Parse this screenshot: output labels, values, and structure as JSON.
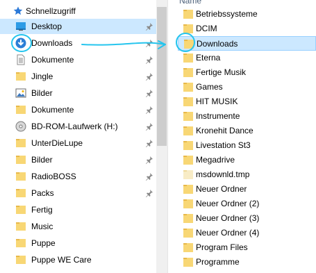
{
  "nav": {
    "quick_access_label": "Schnellzugriff",
    "items": [
      {
        "label": "Desktop",
        "icon": "desktop-icon",
        "pinned": true
      },
      {
        "label": "Downloads",
        "icon": "download-arrow-icon",
        "pinned": true
      },
      {
        "label": "Dokumente",
        "icon": "document-icon",
        "pinned": true
      },
      {
        "label": "Jingle",
        "icon": "folder-icon",
        "pinned": true
      },
      {
        "label": "Bilder",
        "icon": "pictures-icon",
        "pinned": true
      },
      {
        "label": "Dokumente",
        "icon": "folder-icon",
        "pinned": true
      },
      {
        "label": "BD-ROM-Laufwerk (H:)",
        "icon": "disc-drive-icon",
        "pinned": true
      },
      {
        "label": "UnterDieLupe",
        "icon": "folder-icon",
        "pinned": true
      },
      {
        "label": "Bilder",
        "icon": "folder-icon",
        "pinned": true
      },
      {
        "label": "RadioBOSS",
        "icon": "folder-icon",
        "pinned": true
      },
      {
        "label": "Packs",
        "icon": "folder-icon",
        "pinned": true
      },
      {
        "label": "Fertig",
        "icon": "folder-icon",
        "pinned": false
      },
      {
        "label": "Music",
        "icon": "folder-icon",
        "pinned": false
      },
      {
        "label": "Puppe",
        "icon": "folder-icon",
        "pinned": false
      },
      {
        "label": "Puppe WE Care",
        "icon": "folder-icon",
        "pinned": false
      }
    ]
  },
  "list": {
    "header": "Name",
    "items": [
      {
        "label": "Betriebssysteme",
        "icon": "folder-icon"
      },
      {
        "label": "DCIM",
        "icon": "folder-icon"
      },
      {
        "label": "Downloads",
        "icon": "folder-icon"
      },
      {
        "label": "Eterna",
        "icon": "folder-icon"
      },
      {
        "label": "Fertige Musik",
        "icon": "folder-icon"
      },
      {
        "label": "Games",
        "icon": "folder-icon"
      },
      {
        "label": "HIT MUSIK",
        "icon": "folder-icon"
      },
      {
        "label": "Instrumente",
        "icon": "folder-icon"
      },
      {
        "label": "Kronehit Dance",
        "icon": "folder-icon"
      },
      {
        "label": "Livestation St3",
        "icon": "folder-icon"
      },
      {
        "label": "Megadrive",
        "icon": "folder-icon"
      },
      {
        "label": "msdownld.tmp",
        "icon": "hidden-folder-icon"
      },
      {
        "label": "Neuer Ordner",
        "icon": "folder-icon"
      },
      {
        "label": "Neuer Ordner (2)",
        "icon": "folder-icon"
      },
      {
        "label": "Neuer Ordner (3)",
        "icon": "folder-icon"
      },
      {
        "label": "Neuer Ordner (4)",
        "icon": "folder-icon"
      },
      {
        "label": "Program Files",
        "icon": "folder-icon"
      },
      {
        "label": "Programme",
        "icon": "folder-icon"
      }
    ]
  },
  "colors": {
    "selection": "#cce8ff",
    "folder": "#f8d775",
    "annotation": "#25c5ee"
  }
}
